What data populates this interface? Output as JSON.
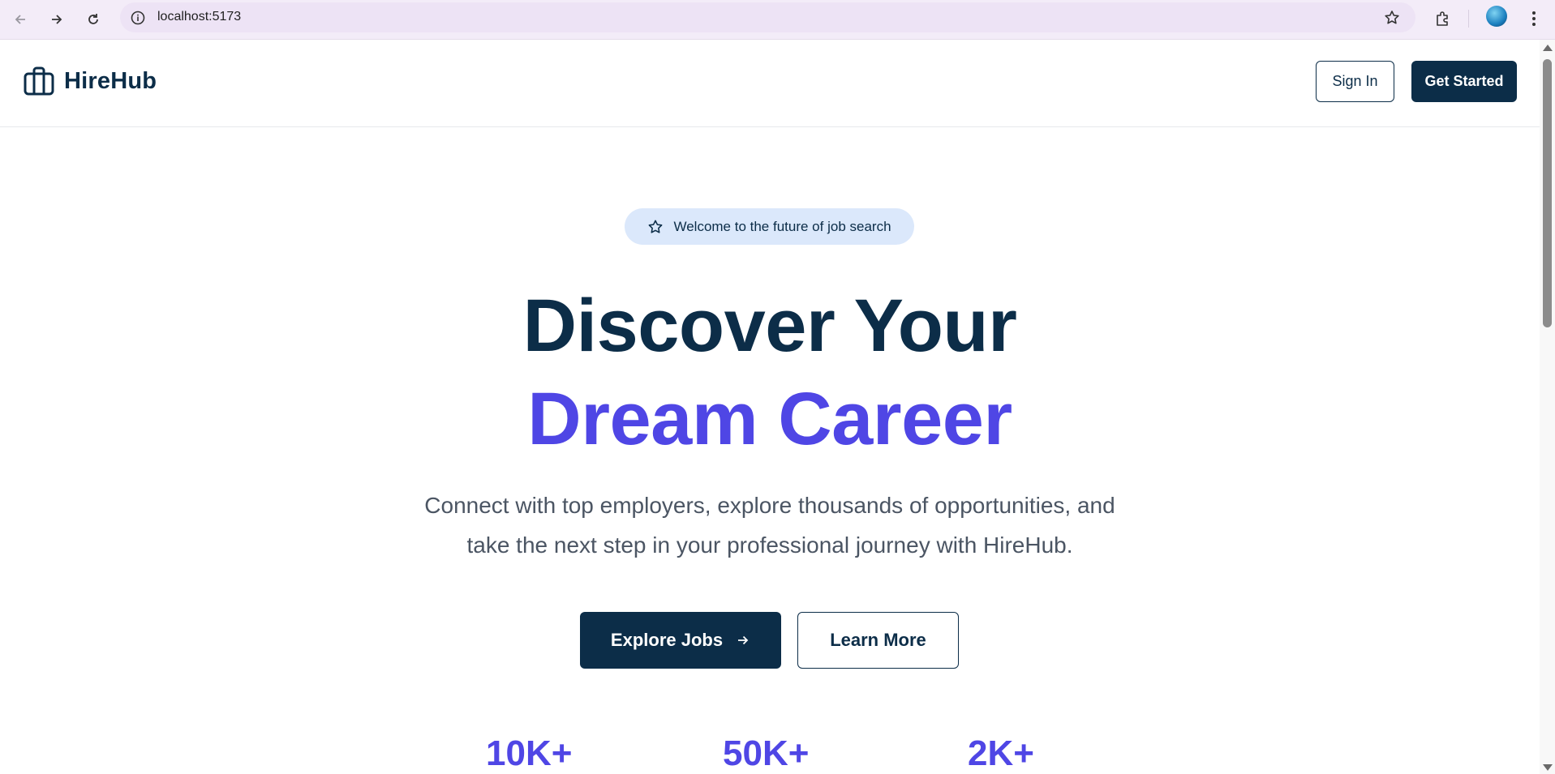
{
  "browser": {
    "url": "localhost:5173",
    "icons": [
      "back-arrow-icon",
      "forward-arrow-icon",
      "reload-icon",
      "site-info-icon",
      "bookmark-star-icon",
      "extensions-icon",
      "profile-avatar",
      "more-menu-icon"
    ]
  },
  "header": {
    "brand": "HireHub",
    "sign_in": "Sign In",
    "get_started": "Get Started"
  },
  "hero": {
    "badge": "Welcome to the future of job search",
    "title_line1": "Discover Your",
    "title_line2": "Dream Career",
    "subtitle_line1": "Connect with top employers, explore thousands of opportunities, and",
    "subtitle_line2": "take the next step in your professional journey with HireHub.",
    "explore_jobs": "Explore Jobs",
    "learn_more": "Learn More"
  },
  "stats": [
    {
      "value": "10K+"
    },
    {
      "value": "50K+"
    },
    {
      "value": "2K+"
    }
  ],
  "colors": {
    "navy": "#0c2d48",
    "accent": "#4f46e5",
    "badge_bg": "#dbe8fb"
  }
}
